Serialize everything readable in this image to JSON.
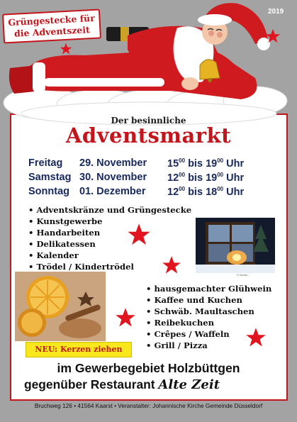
{
  "poster": {
    "year": "2019",
    "tagline_line1": "Grüngestecke für",
    "tagline_line2": "die Adventszeit",
    "subtitle": "Der besinnliche",
    "title": "Adventsmarkt"
  },
  "schedule": [
    {
      "day": "Freitag",
      "date": "29. November",
      "from_h": "15",
      "from_m": "00",
      "to_word": "bis",
      "to_h": "19",
      "to_m": "00",
      "unit": "Uhr"
    },
    {
      "day": "Samstag",
      "date": "30. November",
      "from_h": "12",
      "from_m": "00",
      "to_word": "bis",
      "to_h": "19",
      "to_m": "00",
      "unit": "Uhr"
    },
    {
      "day": "Sonntag",
      "date": "01. Dezember",
      "from_h": "12",
      "from_m": "00",
      "to_word": "bis",
      "to_h": "18",
      "to_m": "00",
      "unit": "Uhr"
    }
  ],
  "offers_left": [
    "Adventskränze und Grüngestecke",
    "Kunstgewerbe",
    "Handarbeiten",
    "Delikatessen",
    "Kalender",
    "Trödel / Kindertrödel"
  ],
  "offers_right": [
    "hausgemachter Glühwein",
    "Kaffee und Kuchen",
    "Schwäb. Maultaschen",
    "Reibekuchen",
    "Crêpes / Waffeln",
    "Grill / Pizza"
  ],
  "photo_credit": "© fotolia ...",
  "highlight": "NEU: Kerzen ziehen",
  "location": {
    "line1": "im Gewerbegebiet Holzbüttgen",
    "line2_prefix": "gegenüber Restaurant",
    "restaurant": "Alte Zeit"
  },
  "footer": "Bruchweg 126 • 41564 Kaarst • Veranstalter: Johannische Kirche Gemeinde Düsseldorf",
  "colors": {
    "accent_red": "#c3161c",
    "schedule_blue": "#17285e",
    "highlight_yellow": "#f8e71c",
    "background_gray": "#a3a3a3"
  },
  "icons": [
    "star-icon",
    "santa-illustration",
    "window-photo",
    "orange-cinnamon-photo"
  ]
}
